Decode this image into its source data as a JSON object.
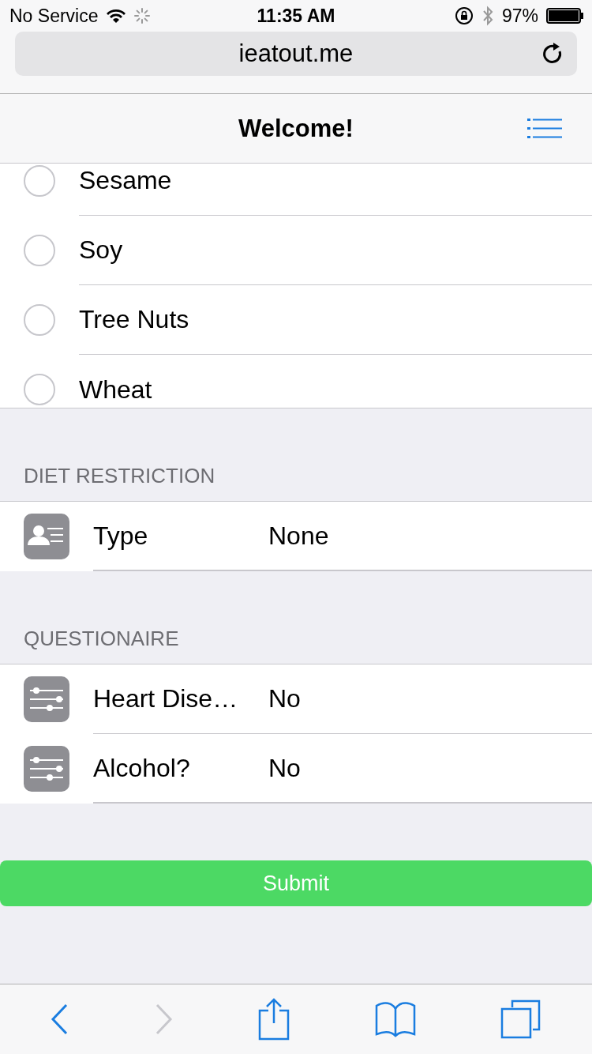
{
  "status_bar": {
    "carrier": "No Service",
    "time": "11:35 AM",
    "battery": "97%"
  },
  "address_bar": {
    "url": "ieatout.me"
  },
  "nav_bar": {
    "title": "Welcome!"
  },
  "allergies": [
    {
      "label": "Sesame",
      "checked": false
    },
    {
      "label": "Soy",
      "checked": false
    },
    {
      "label": "Tree Nuts",
      "checked": false
    },
    {
      "label": "Wheat",
      "checked": false
    }
  ],
  "sections": [
    {
      "header": "DIET RESTRICTION",
      "rows": [
        {
          "kind": "person",
          "label": "Type",
          "value": "None"
        }
      ]
    },
    {
      "header": "QUESTIONAIRE",
      "rows": [
        {
          "kind": "sliders",
          "label": "Heart Dise…",
          "value": "No"
        },
        {
          "kind": "sliders",
          "label": "Alcohol?",
          "value": "No"
        }
      ]
    }
  ],
  "submit": {
    "label": "Submit"
  },
  "toolbar": {
    "back_disabled": false,
    "forward_disabled": true
  }
}
